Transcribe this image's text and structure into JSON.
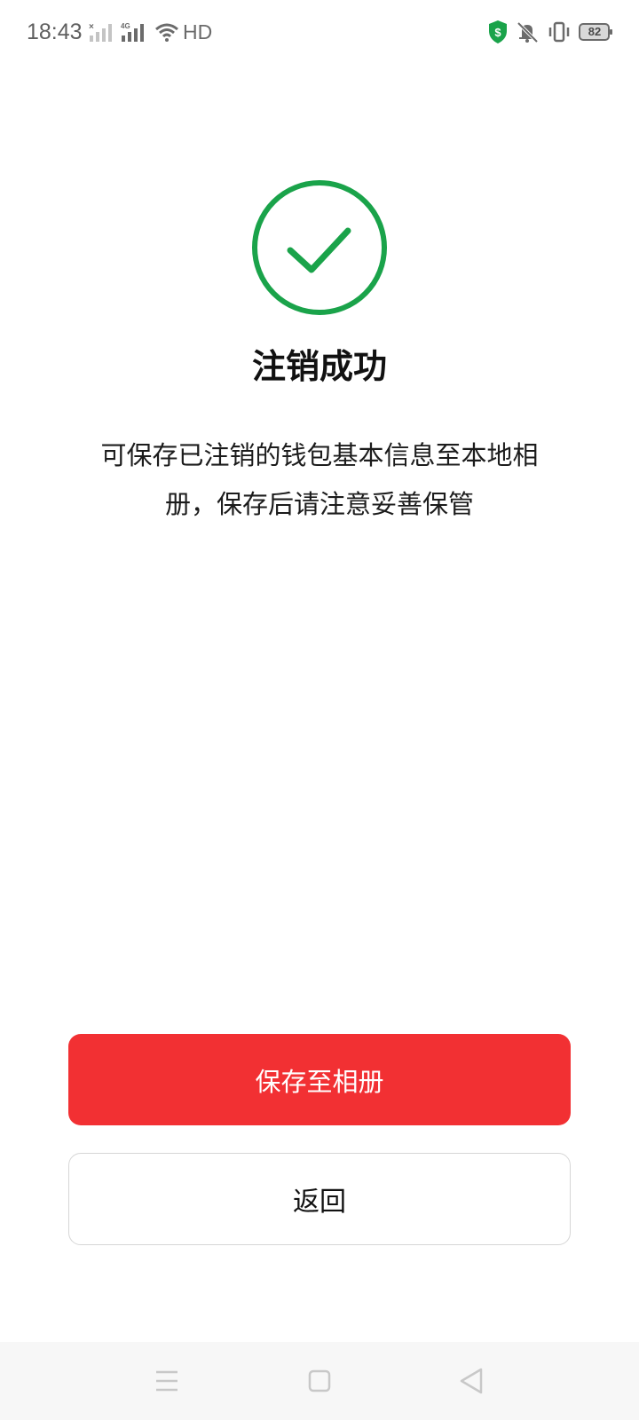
{
  "status_bar": {
    "time": "18:43",
    "network_label": "4G",
    "hd_label": "HD",
    "battery_level": "82",
    "shield_color": "#1aa34a"
  },
  "success": {
    "icon": "check-circle-icon",
    "color": "#1aa34a",
    "title": "注销成功",
    "description": "可保存已注销的钱包基本信息至本地相册，保存后请注意妥善保管"
  },
  "actions": {
    "save_label": "保存至相册",
    "back_label": "返回",
    "primary_color": "#f23033"
  },
  "nav_bar": {
    "icons": [
      "menu-icon",
      "home-square-icon",
      "back-triangle-icon"
    ]
  }
}
